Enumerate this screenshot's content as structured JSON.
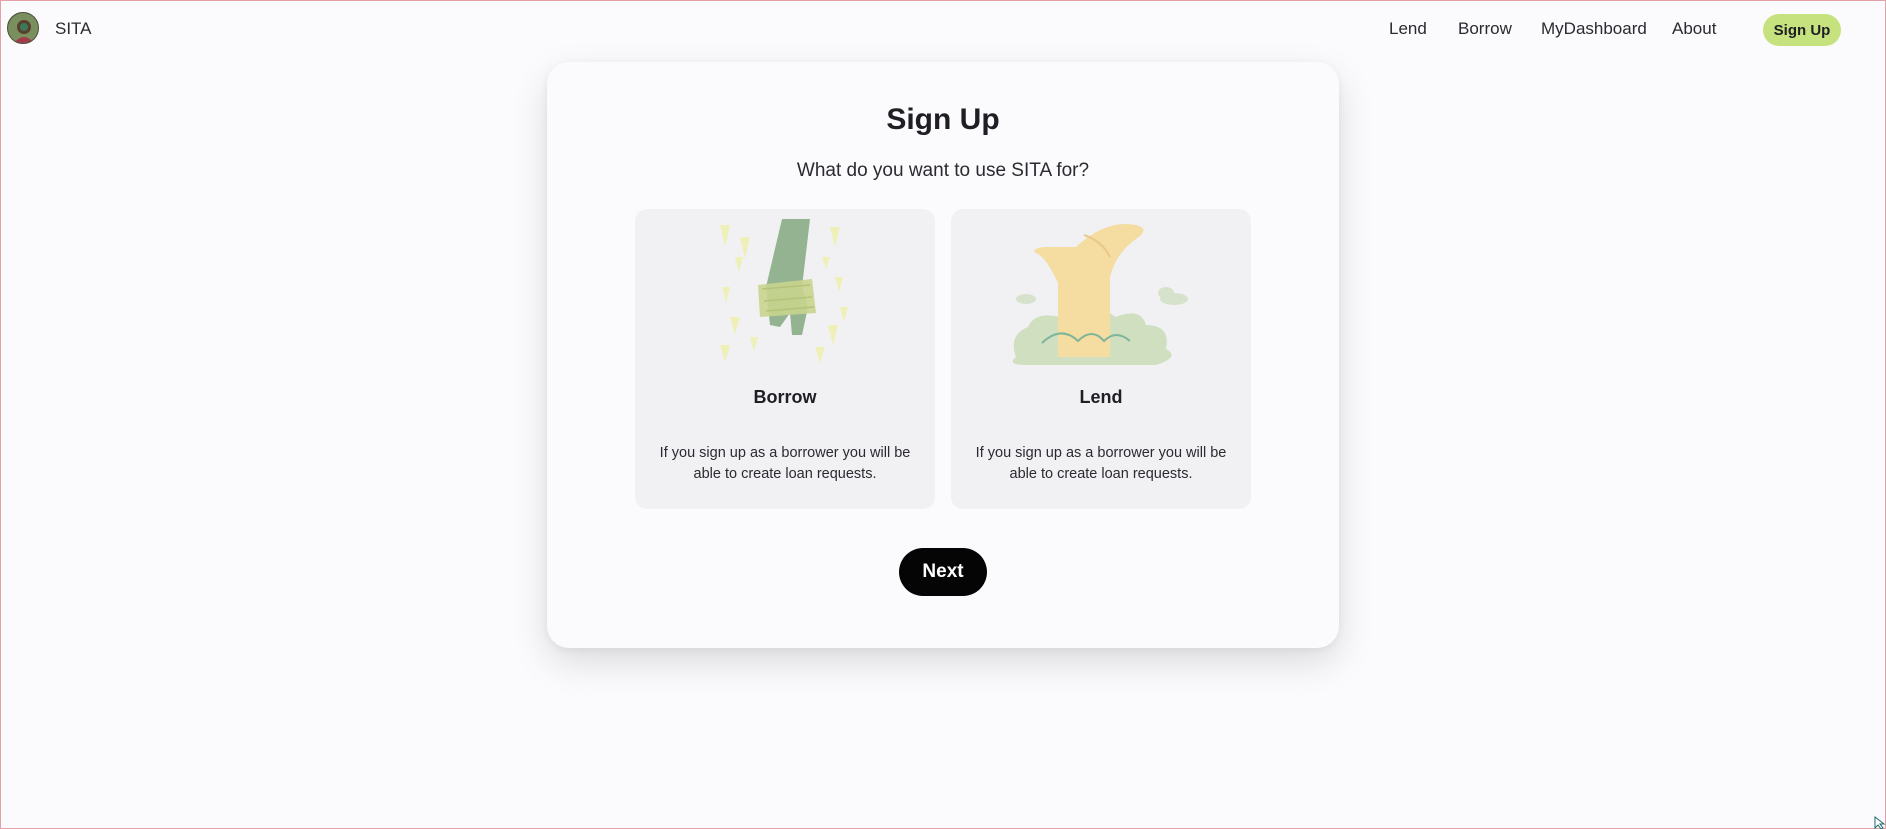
{
  "nav": {
    "brand": "SITA",
    "links": [
      "Lend",
      "Borrow",
      "MyDashboard",
      "About"
    ],
    "signup_label": "Sign Up"
  },
  "signup": {
    "title": "Sign Up",
    "question": "What do you want to use SITA for?",
    "options": [
      {
        "title": "Borrow",
        "description": "If you sign up as a borrower you will be able to create loan requests.",
        "icon": "hand-receiving-money-illustration"
      },
      {
        "title": "Lend",
        "description": "If you sign up as a borrower you will be able to create loan requests.",
        "icon": "open-hand-illustration"
      }
    ],
    "next_label": "Next"
  },
  "colors": {
    "accent": "#c6e27e",
    "button_dark": "#050505",
    "card_bg": "#f1f1f4",
    "page_bg": "#fbfafc"
  }
}
